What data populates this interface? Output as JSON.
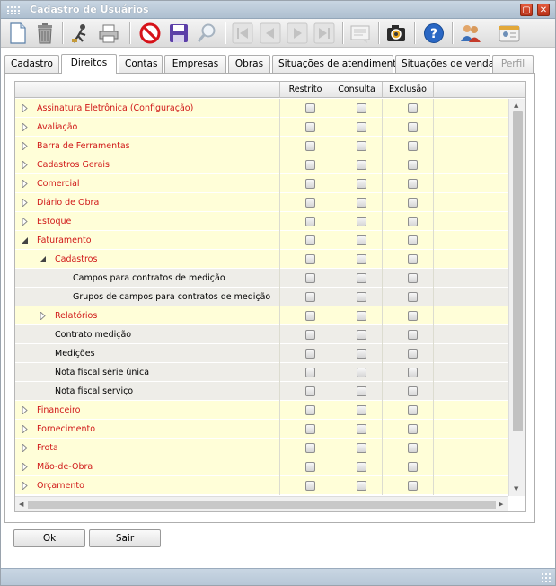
{
  "window": {
    "title": "Cadastro de Usuários"
  },
  "toolbar": {
    "buttons": [
      {
        "icon": "new-document-icon",
        "enabled": true
      },
      {
        "icon": "trash-icon",
        "enabled": true
      },
      {
        "icon": "edit-icon",
        "enabled": true
      },
      {
        "icon": "printer-icon",
        "enabled": true
      },
      {
        "icon": "cancel-icon",
        "enabled": true
      },
      {
        "icon": "save-icon",
        "enabled": true
      },
      {
        "icon": "search-icon",
        "enabled": false
      },
      {
        "icon": "first-record-icon",
        "enabled": false
      },
      {
        "icon": "previous-record-icon",
        "enabled": false
      },
      {
        "icon": "next-record-icon",
        "enabled": false
      },
      {
        "icon": "last-record-icon",
        "enabled": false
      },
      {
        "icon": "notes-icon",
        "enabled": false
      },
      {
        "icon": "camera-icon",
        "enabled": true
      },
      {
        "icon": "help-icon",
        "enabled": true
      },
      {
        "icon": "users-icon",
        "enabled": true
      },
      {
        "icon": "user-card-icon",
        "enabled": true
      }
    ]
  },
  "tabs": [
    {
      "label": "Cadastro",
      "state": "normal"
    },
    {
      "label": "Direitos",
      "state": "active"
    },
    {
      "label": "Contas",
      "state": "normal"
    },
    {
      "label": "Empresas",
      "state": "normal"
    },
    {
      "label": "Obras",
      "state": "normal"
    },
    {
      "label": "Situações de atendimento",
      "state": "normal"
    },
    {
      "label": "Situações de venda",
      "state": "normal"
    },
    {
      "label": "Perfil",
      "state": "disabled"
    }
  ],
  "grid": {
    "columns": [
      "Restrito",
      "Consulta",
      "Exclusão"
    ],
    "rows": [
      {
        "label": "Assinatura Eletrônica (Configuração)",
        "level": 0,
        "expander": "collapsed",
        "style": "category"
      },
      {
        "label": "Avaliação",
        "level": 0,
        "expander": "collapsed",
        "style": "category"
      },
      {
        "label": "Barra de Ferramentas",
        "level": 0,
        "expander": "collapsed",
        "style": "category"
      },
      {
        "label": "Cadastros Gerais",
        "level": 0,
        "expander": "collapsed",
        "style": "category"
      },
      {
        "label": "Comercial",
        "level": 0,
        "expander": "collapsed",
        "style": "category"
      },
      {
        "label": "Diário de Obra",
        "level": 0,
        "expander": "collapsed",
        "style": "category"
      },
      {
        "label": "Estoque",
        "level": 0,
        "expander": "collapsed",
        "style": "category"
      },
      {
        "label": "Faturamento",
        "level": 0,
        "expander": "expanded",
        "style": "category"
      },
      {
        "label": "Cadastros",
        "level": 1,
        "expander": "expanded",
        "style": "category"
      },
      {
        "label": "Campos para contratos de medição",
        "level": 2,
        "expander": "none",
        "style": "item"
      },
      {
        "label": "Grupos de campos para contratos de medição",
        "level": 2,
        "expander": "none",
        "style": "item"
      },
      {
        "label": "Relatórios",
        "level": 1,
        "expander": "collapsed",
        "style": "category"
      },
      {
        "label": "Contrato medição",
        "level": 1,
        "expander": "none",
        "style": "item"
      },
      {
        "label": "Medições",
        "level": 1,
        "expander": "none",
        "style": "item"
      },
      {
        "label": "Nota fiscal série única",
        "level": 1,
        "expander": "none",
        "style": "item"
      },
      {
        "label": "Nota fiscal serviço",
        "level": 1,
        "expander": "none",
        "style": "item"
      },
      {
        "label": "Financeiro",
        "level": 0,
        "expander": "collapsed",
        "style": "category"
      },
      {
        "label": "Fornecimento",
        "level": 0,
        "expander": "collapsed",
        "style": "category"
      },
      {
        "label": "Frota",
        "level": 0,
        "expander": "collapsed",
        "style": "category"
      },
      {
        "label": "Mão-de-Obra",
        "level": 0,
        "expander": "collapsed",
        "style": "category"
      },
      {
        "label": "Orçamento",
        "level": 0,
        "expander": "collapsed",
        "style": "category"
      }
    ]
  },
  "footer": {
    "ok_label": "Ok",
    "exit_label": "Sair"
  },
  "colors": {
    "category_text": "#d01818",
    "highlight_row": "#fffed8",
    "item_row": "#eeede8",
    "titlebar": "#b7c7d7"
  }
}
